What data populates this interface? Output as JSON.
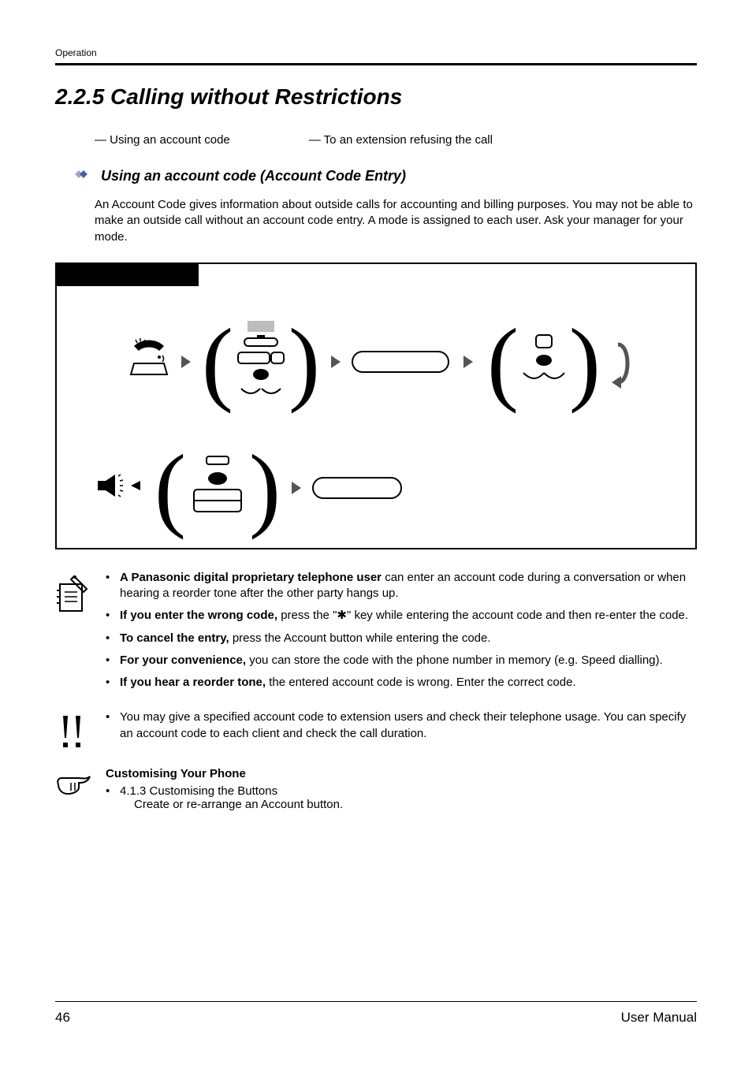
{
  "running_head": "Operation",
  "title": "2.2.5   Calling without Restrictions",
  "links": {
    "left": "— Using an account code",
    "right": "— To an extension refusing the call"
  },
  "subhead": "Using an account code (Account Code Entry)",
  "intro": "An Account Code gives information about outside calls for accounting and billing purposes. You may not be able to make an outside call without an account code entry. A mode is assigned to each user. Ask your manager for your mode.",
  "note1_items": [
    {
      "bold": "A Panasonic digital proprietary telephone user",
      "rest": " can enter an account code during a conversation or when hearing a reorder tone after the other party hangs up."
    },
    {
      "bold": "If you enter the wrong code,",
      "rest": " press the \"",
      "star": true,
      "after_star": "\" key while entering the account code and then re-enter the code."
    },
    {
      "bold": "To cancel the entry,",
      "rest": " press the Account button while entering the code."
    },
    {
      "bold": "For your convenience,",
      "rest": " you can store the code with the phone number in memory (e.g. Speed dialling)."
    },
    {
      "bold": "If you hear a reorder tone,",
      "rest": " the entered account code is wrong. Enter the correct code."
    }
  ],
  "note2_items": [
    {
      "text": "You may give a specified account code to extension users and check their telephone usage. You can specify an account code to each client and check the call duration."
    }
  ],
  "note3_heading": "Customising Your Phone",
  "note3_items": [
    {
      "line1": "4.1.3   Customising the Buttons",
      "line2": "Create or re-arrange an Account button."
    }
  ],
  "footer": {
    "page": "46",
    "label": "User Manual"
  }
}
